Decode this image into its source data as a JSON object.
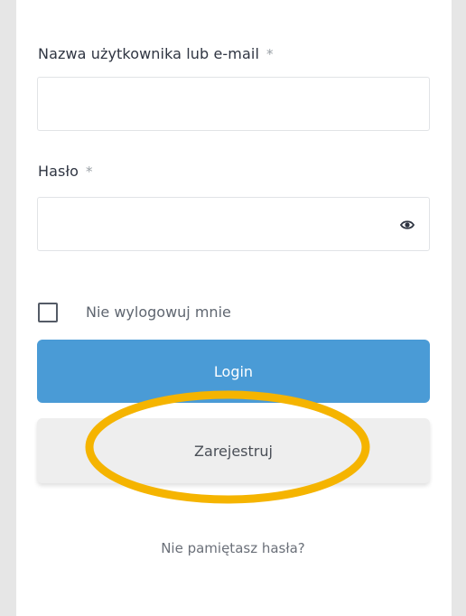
{
  "form": {
    "username_label": "Nazwa użytkownika lub e-mail",
    "username_required": "*",
    "username_value": "",
    "password_label": "Hasło",
    "password_required": "*",
    "password_value": "",
    "remember_label": "Nie wylogowuj mnie",
    "remember_checked": false,
    "login_label": "Login",
    "register_label": "Zarejestruj",
    "forgot_label": "Nie pamiętasz hasła?"
  },
  "colors": {
    "login_bg": "#4a9bd6",
    "register_bg": "#eeeeee",
    "highlight": "#f5b400",
    "page_bg": "#e6e6e6"
  },
  "icons": {
    "password_toggle": "eye-icon"
  }
}
